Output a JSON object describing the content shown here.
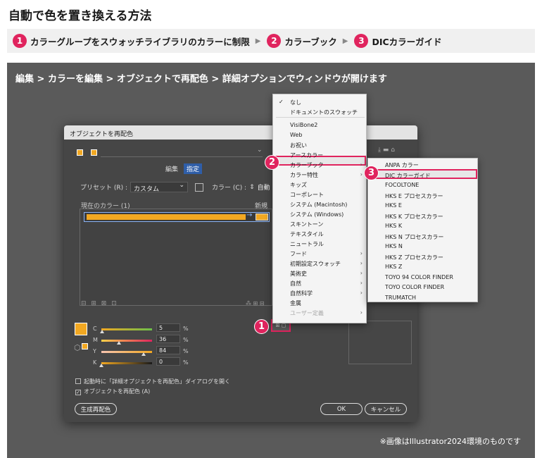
{
  "page_title": "自動で色を置き換える方法",
  "steps": [
    {
      "num": "1",
      "label": "カラーグループをスウォッチライブラリのカラーに制限"
    },
    {
      "num": "2",
      "label": "カラーブック"
    },
    {
      "num": "3",
      "label": "DICカラーガイド"
    }
  ],
  "menu_path": "編集 > カラーを編集 > オブジェクトで再配色 > 詳細オプションでウィンドウが開けます",
  "dialog": {
    "title": "オブジェクトを再配色",
    "tab_edit": "編集",
    "tab_assign": "指定",
    "preset_label": "プリセット (R) :",
    "preset_value": "カスタム",
    "color_label": "カラー (C) :",
    "color_value": "自動",
    "current_colors": "現在のカラー (1)",
    "new_label": "新規",
    "sliders": [
      {
        "label": "C",
        "value": "5"
      },
      {
        "label": "M",
        "value": "36"
      },
      {
        "label": "Y",
        "value": "84"
      },
      {
        "label": "K",
        "value": "0"
      }
    ],
    "percent": "%",
    "open_on_launch": "起動時に「詳細オプジェクトを再配色」ダイアログを開く",
    "recolor_art": "オブジェクトを再配色 (A)",
    "generate_button": "生成再配色",
    "ok_button": "OK",
    "cancel_button": "キャンセル",
    "library_icon": "⊞ ▢"
  },
  "main_menu": {
    "items": [
      {
        "label": "なし",
        "checked": true
      },
      {
        "label": "ドキュメントのスウォッチ"
      },
      {
        "label": "VisiBone2"
      },
      {
        "label": "Web"
      },
      {
        "label": "お祝い"
      },
      {
        "label": "アースカラー"
      },
      {
        "label": "カラーブック",
        "submenu": true,
        "highlight": true
      },
      {
        "label": "カラー特性",
        "submenu": true
      },
      {
        "label": "キッズ"
      },
      {
        "label": "コーポレート"
      },
      {
        "label": "システム (Macintosh)"
      },
      {
        "label": "システム (Windows)"
      },
      {
        "label": "スキントーン"
      },
      {
        "label": "テキスタイル"
      },
      {
        "label": "ニュートラル"
      },
      {
        "label": "フード",
        "submenu": true
      },
      {
        "label": "初期設定スウォッチ",
        "submenu": true
      },
      {
        "label": "美術史",
        "submenu": true
      },
      {
        "label": "自然",
        "submenu": true
      },
      {
        "label": "自然科学",
        "submenu": true
      },
      {
        "label": "金属"
      },
      {
        "label": "ユーザー定義",
        "submenu": true,
        "disabled": true
      }
    ]
  },
  "sub_menu": {
    "items": [
      {
        "label": "ANPA カラー"
      },
      {
        "label": "DIC カラーガイド",
        "highlight": true
      },
      {
        "label": "FOCOLTONE"
      },
      {
        "label": "HKS E プロセスカラー"
      },
      {
        "label": "HKS E"
      },
      {
        "label": "HKS K プロセスカラー"
      },
      {
        "label": "HKS K"
      },
      {
        "label": "HKS N プロセスカラー"
      },
      {
        "label": "HKS N"
      },
      {
        "label": "HKS Z プロセスカラー"
      },
      {
        "label": "HKS Z"
      },
      {
        "label": "TOYO 94 COLOR FINDER"
      },
      {
        "label": "TOYO COLOR FINDER"
      },
      {
        "label": "TRUMATCH"
      }
    ]
  },
  "callouts": [
    "1",
    "2",
    "3"
  ],
  "footnote": "※画像はIllustrator2024環境のものです",
  "colors": {
    "accent": "#e0245e",
    "swatch": "#f2a822",
    "background": "#5a5a5a"
  }
}
